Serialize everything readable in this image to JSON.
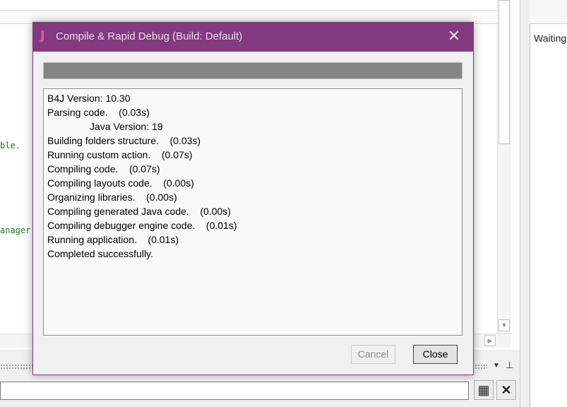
{
  "background": {
    "code_lines": [
      "ble.",
      "anager"
    ],
    "right_panel_text": "Waiting"
  },
  "dialog": {
    "logo_glyph": "J",
    "title": "Compile & Rapid Debug (Build: Default)",
    "close_glyph": "✕",
    "progress_percent": 100,
    "log_lines": [
      {
        "text": "B4J Version: 10.30",
        "indent": false
      },
      {
        "text": "Parsing code.    (0.03s)",
        "indent": false
      },
      {
        "text": "Java Version: 19",
        "indent": true
      },
      {
        "text": "Building folders structure.    (0.03s)",
        "indent": false
      },
      {
        "text": "Running custom action.    (0.07s)",
        "indent": false
      },
      {
        "text": "Compiling code.    (0.07s)",
        "indent": false
      },
      {
        "text": "Compiling layouts code.    (0.00s)",
        "indent": false
      },
      {
        "text": "Organizing libraries.    (0.00s)",
        "indent": false
      },
      {
        "text": "Compiling generated Java code.    (0.00s)",
        "indent": false
      },
      {
        "text": "Compiling debugger engine code.    (0.01s)",
        "indent": false
      },
      {
        "text": "Running application.    (0.01s)",
        "indent": false
      },
      {
        "text": "Completed successfully.",
        "indent": false
      }
    ],
    "cancel_label": "Cancel",
    "close_label": "Close"
  },
  "colors": {
    "titlebar": "#833a7e",
    "logo": "#e35aa2",
    "code_text": "#1f7a1f"
  }
}
